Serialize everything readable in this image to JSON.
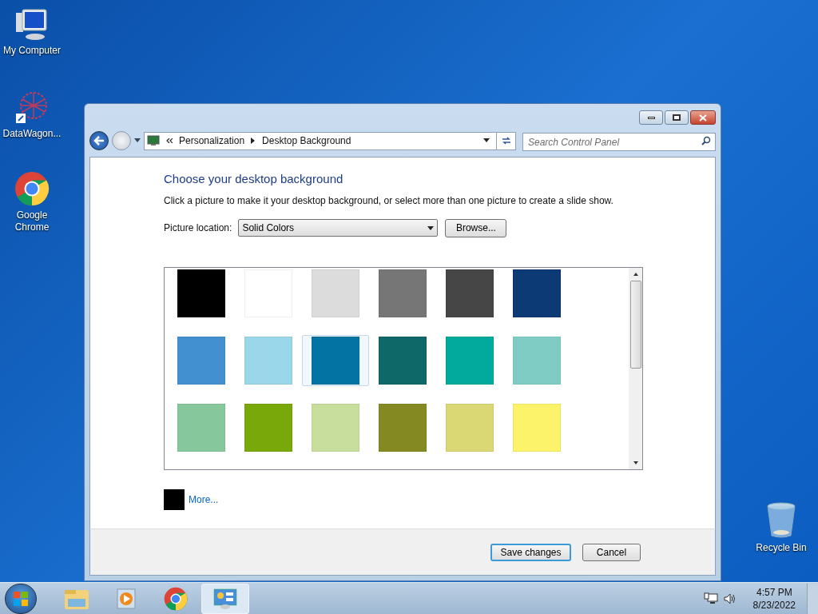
{
  "desktop_icons": [
    {
      "kind": "computer",
      "label": "My Computer"
    },
    {
      "kind": "network",
      "label": "DataWagon..."
    },
    {
      "kind": "chrome",
      "label": "Google Chrome"
    },
    {
      "kind": "recycle",
      "label": "Recycle Bin"
    }
  ],
  "window": {
    "breadcrumb": [
      "Personalization",
      "Desktop Background"
    ],
    "search": {
      "placeholder": "Search Control Panel"
    },
    "heading": "Choose your desktop background",
    "description": "Click a picture to make it your desktop background, or select more than one picture to create a slide show.",
    "location_label": "Picture location:",
    "location_value": "Solid Colors",
    "browse_button": "Browse...",
    "swatches": [
      {
        "color": "#000000",
        "highlighted": false
      },
      {
        "color": "#ffffff",
        "highlighted": false
      },
      {
        "color": "#dcdcdc",
        "highlighted": false
      },
      {
        "color": "#767676",
        "highlighted": false
      },
      {
        "color": "#464646",
        "highlighted": false
      },
      {
        "color": "#0c3a75",
        "highlighted": false
      },
      {
        "color": "#4290d0",
        "highlighted": false
      },
      {
        "color": "#9bd7ea",
        "highlighted": false
      },
      {
        "color": "#0373a3",
        "highlighted": true
      },
      {
        "color": "#0d6867",
        "highlighted": false
      },
      {
        "color": "#01aa9c",
        "highlighted": false
      },
      {
        "color": "#7fccc5",
        "highlighted": false
      },
      {
        "color": "#86c79c",
        "highlighted": false
      },
      {
        "color": "#78a80a",
        "highlighted": false
      },
      {
        "color": "#c8de9c",
        "highlighted": false
      },
      {
        "color": "#848a21",
        "highlighted": false
      },
      {
        "color": "#dad775",
        "highlighted": false
      },
      {
        "color": "#fcf36a",
        "highlighted": false
      }
    ],
    "current_swatch": {
      "color": "#000000"
    },
    "more_link": "More...",
    "buttons": [
      {
        "label": "Save changes",
        "selected": true
      },
      {
        "label": "Cancel",
        "selected": false
      }
    ]
  },
  "taskbar": {
    "items": [
      {
        "kind": "explorer",
        "selected": false
      },
      {
        "kind": "media",
        "selected": false
      },
      {
        "kind": "chrome",
        "selected": false
      },
      {
        "kind": "control-panel",
        "selected": true
      }
    ],
    "time": "4:57 PM",
    "date": "8/23/2022"
  }
}
